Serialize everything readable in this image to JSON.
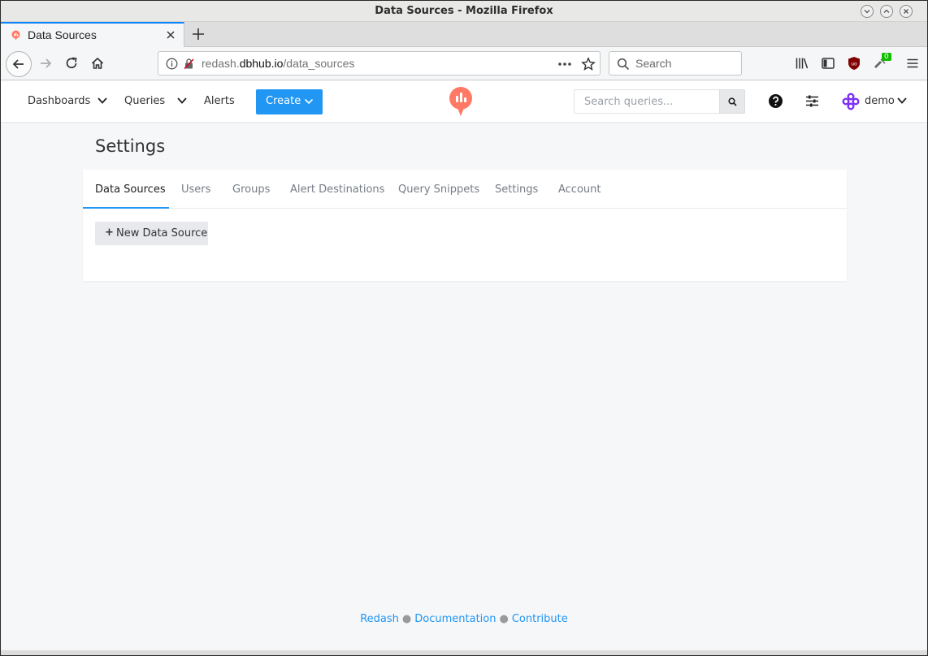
{
  "window": {
    "title": "Data Sources - Mozilla Firefox"
  },
  "browser": {
    "tab_title": "Data Sources",
    "url_prefix": "redash.",
    "url_domain": "dbhub.io",
    "url_path": "/data_sources",
    "search_placeholder": "Search",
    "ublock_badge": "0"
  },
  "header": {
    "menu": [
      "Dashboards",
      "Queries",
      "Alerts"
    ],
    "create_label": "Create",
    "search_placeholder": "Search queries...",
    "user_name": "demo",
    "brand_color": "#ff7964",
    "accent_color": "#2196f3"
  },
  "page": {
    "title": "Settings",
    "tabs": [
      "Data Sources",
      "Users",
      "Groups",
      "Alert Destinations",
      "Query Snippets",
      "Settings",
      "Account"
    ],
    "active_tab": "Data Sources",
    "new_button_icon": "+",
    "new_button_label": "New Data Source"
  },
  "footer": {
    "links": [
      "Redash",
      "Documentation",
      "Contribute"
    ]
  }
}
